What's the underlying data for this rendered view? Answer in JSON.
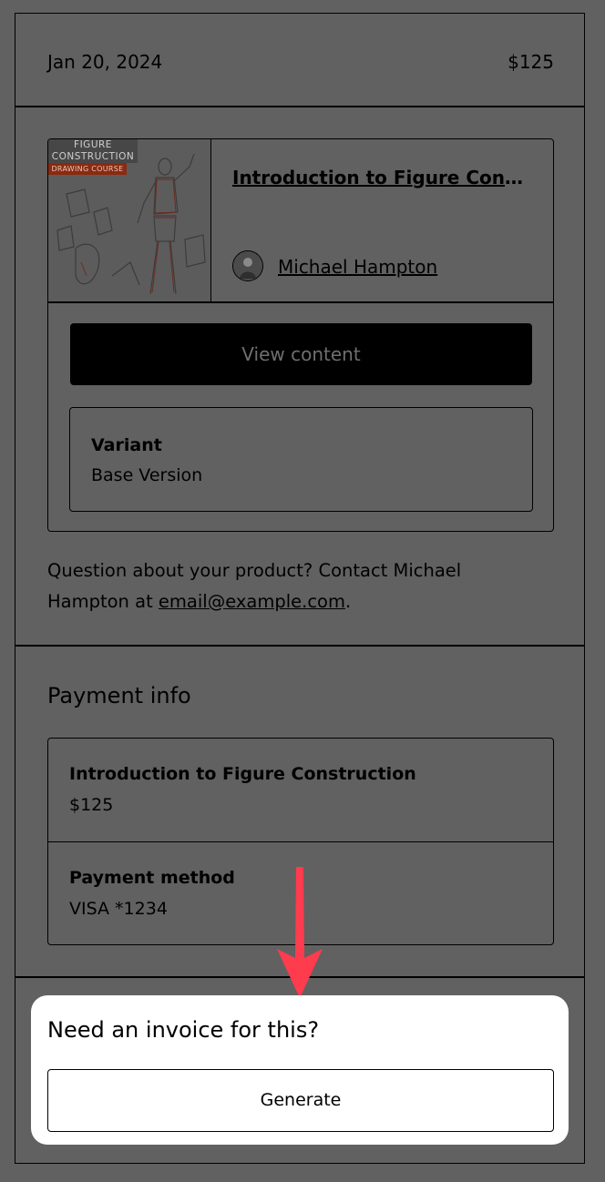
{
  "order": {
    "date": "Jan 20, 2024",
    "price": "$125"
  },
  "product": {
    "thumbnail": {
      "line1": "FIGURE",
      "line2": "CONSTRUCTION",
      "line3": "DRAWING COURSE"
    },
    "title": "Introduction to Figure Const…",
    "author": "Michael Hampton",
    "view_button": "View content",
    "variant_label": "Variant",
    "variant_value": "Base Version"
  },
  "contact": {
    "text": "Question about your product? Contact Michael Hampton at ",
    "email": "email@example.com",
    "suffix": "."
  },
  "payment": {
    "title": "Payment info",
    "item_label": "Introduction to Figure Construction",
    "item_price": "$125",
    "method_label": "Payment method",
    "method_value": "VISA *1234"
  },
  "invoice": {
    "prompt": "Need an invoice for this?",
    "button": "Generate"
  },
  "colors": {
    "overlay": "#616161",
    "arrow": "#ff3b4e",
    "popup": "#ffffff"
  }
}
